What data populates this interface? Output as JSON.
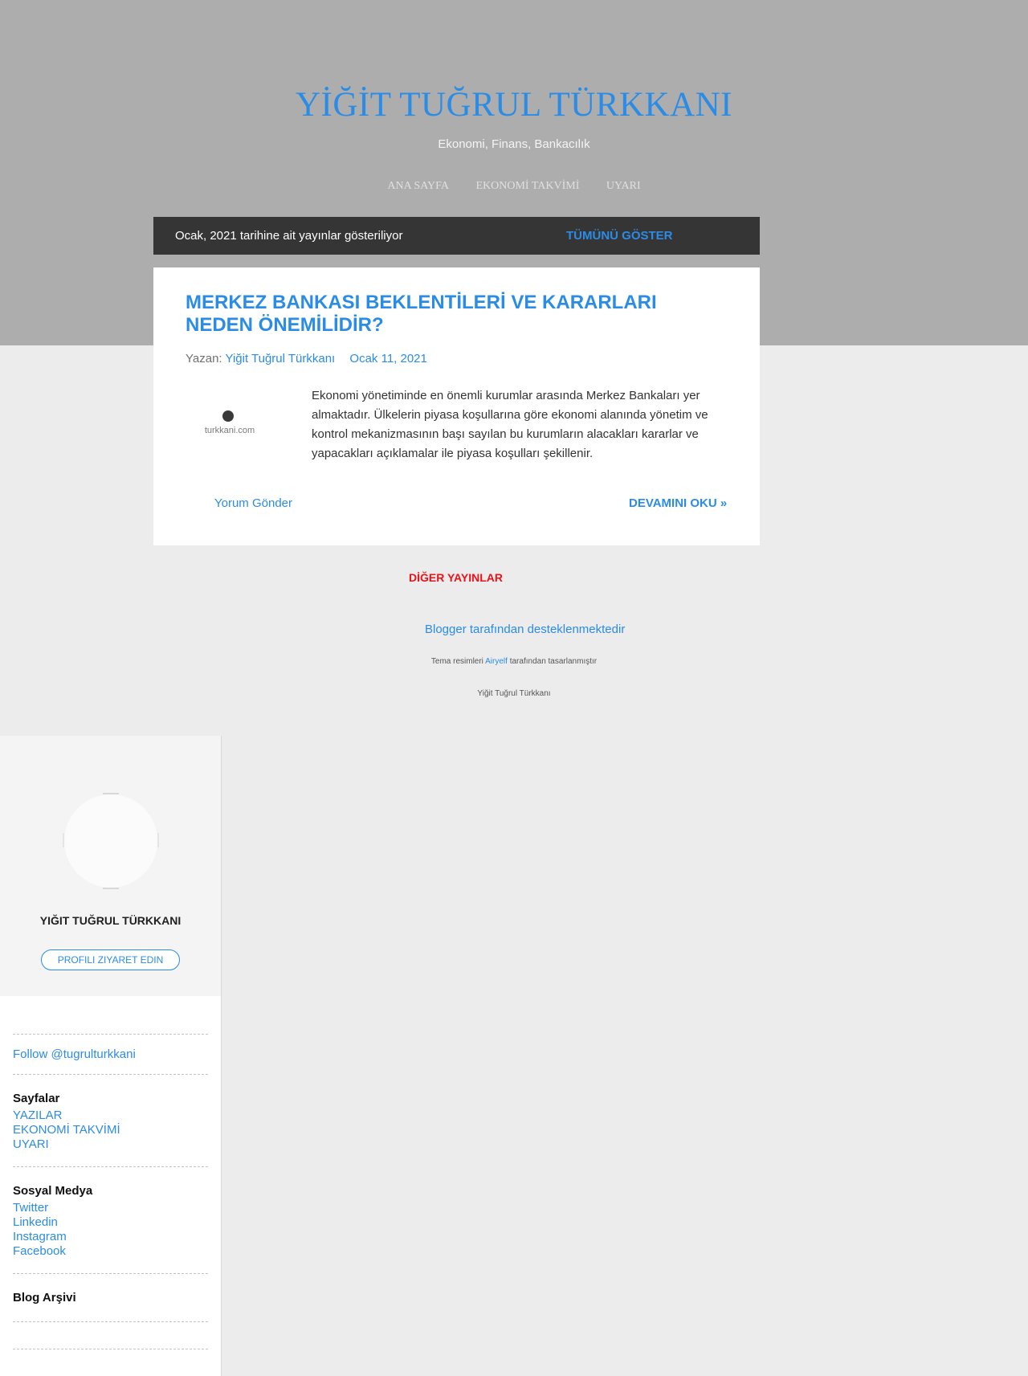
{
  "header": {
    "title": "YİĞİT TUĞRUL TÜRKKANI",
    "description": "Ekonomi, Finans, Bankacılık",
    "nav": [
      "ANA SAYFA",
      "EKONOMİ TAKVİMİ",
      "UYARI"
    ]
  },
  "status": {
    "text": "Ocak, 2021 tarihine ait yayınlar gösteriliyor",
    "show_all": "TÜMÜNÜ GÖSTER"
  },
  "post": {
    "title": "MERKEZ BANKASI BEKLENTİLERİ VE KARARLARI NEDEN ÖNEMİLİDİR?",
    "byline_prefix": "Yazan:",
    "author": "Yiğit Tuğrul Türkkanı",
    "date": "Ocak 11, 2021",
    "thumbnail_text": "turkkani.com",
    "snippet": "Ekonomi yönetiminde en önemli kurumlar arasında Merkez Bankaları yer almaktadır. Ülkelerin piyasa koşullarına göre ekonomi alanında yönetim ve kontrol mekanizmasının başı sayılan bu kurumların alacakları kararlar ve yapacakları açıklamalar ile piyasa koşulları şekillenir.",
    "comment_link": "Yorum Gönder",
    "read_more": "DEVAMINI OKU »"
  },
  "other_posts": "DİĞER YAYINLAR",
  "footer": {
    "powered_by": "Blogger tarafından desteklenmektedir",
    "theme_prefix": "Tema resimleri",
    "theme_author": "Airyelf",
    "theme_suffix": "tarafından tasarlanmıştır",
    "author": "Yiğit Tuğrul Türkkanı"
  },
  "sidebar": {
    "profile_name": "YIĞIT TUĞRUL TÜRKKANI",
    "profile_button": "PROFILI ZIYARET EDIN",
    "follow": "Follow @tugrulturkkani",
    "pages_title": "Sayfalar",
    "pages": [
      "YAZILAR",
      "EKONOMİ TAKVİMİ",
      "UYARI"
    ],
    "social_title": "Sosyal Medya",
    "social": [
      "Twitter",
      "Linkedin",
      "Instagram",
      "Facebook"
    ],
    "archive_title": "Blog Arşivi"
  },
  "colors": {
    "accent": "#2b8ce6",
    "header_bg": "#adadad",
    "page_bg": "#ececec",
    "status_bar_bg": "#353535",
    "other_posts": "#e8141a"
  }
}
